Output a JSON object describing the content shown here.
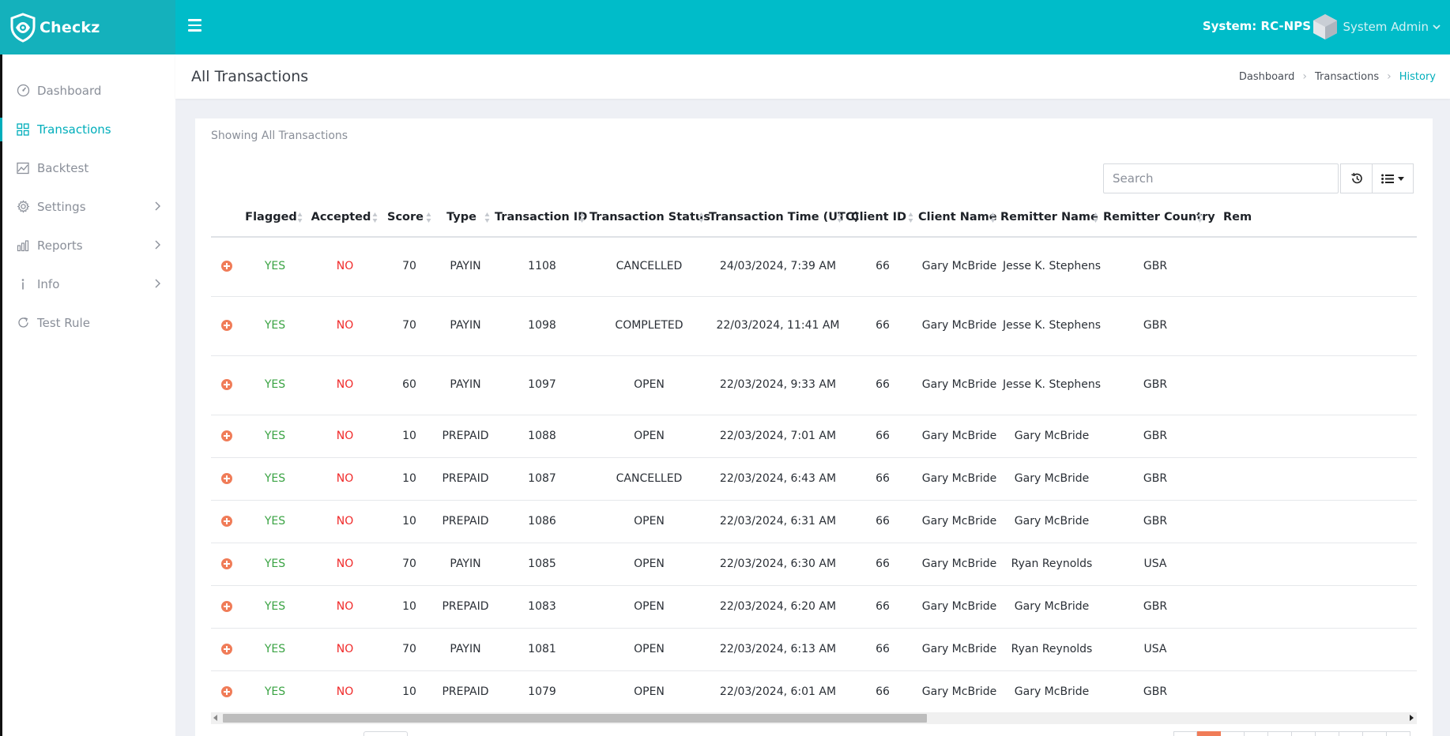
{
  "app": {
    "name": "Checkz"
  },
  "topbar": {
    "system_label": "System: RC-NPS",
    "user_name": "System Admin"
  },
  "sidebar": {
    "items": [
      {
        "label": "Dashboard",
        "icon": "speedometer-icon",
        "active": false,
        "has_submenu": false
      },
      {
        "label": "Transactions",
        "icon": "grid-icon",
        "active": true,
        "has_submenu": false
      },
      {
        "label": "Backtest",
        "icon": "image-chart-icon",
        "active": false,
        "has_submenu": false
      },
      {
        "label": "Settings",
        "icon": "gear-icon",
        "active": false,
        "has_submenu": true
      },
      {
        "label": "Reports",
        "icon": "bar-chart-icon",
        "active": false,
        "has_submenu": true
      },
      {
        "label": "Info",
        "icon": "info-icon",
        "active": false,
        "has_submenu": true
      },
      {
        "label": "Test Rule",
        "icon": "refresh-icon",
        "active": false,
        "has_submenu": false
      }
    ]
  },
  "header": {
    "title": "All Transactions",
    "breadcrumb": [
      "Dashboard",
      "Transactions",
      "History"
    ]
  },
  "card": {
    "subtitle": "Showing All Transactions",
    "search_placeholder": "Search"
  },
  "table": {
    "columns": [
      "",
      "Flagged",
      "Accepted",
      "Score",
      "Type",
      "Transaction ID",
      "Transaction Status",
      "Transaction Time (UTC)",
      "Client ID",
      "Client Name",
      "Remitter Name",
      "Remitter Country",
      "Rem"
    ],
    "rows": [
      [
        "YES",
        "NO",
        "70",
        "PAYIN",
        "1108",
        "CANCELLED",
        "24/03/2024, 7:39 AM",
        "66",
        "Gary McBride",
        "Jesse K. Stephens",
        "GBR"
      ],
      [
        "YES",
        "NO",
        "70",
        "PAYIN",
        "1098",
        "COMPLETED",
        "22/03/2024, 11:41 AM",
        "66",
        "Gary McBride",
        "Jesse K. Stephens",
        "GBR"
      ],
      [
        "YES",
        "NO",
        "60",
        "PAYIN",
        "1097",
        "OPEN",
        "22/03/2024, 9:33 AM",
        "66",
        "Gary McBride",
        "Jesse K. Stephens",
        "GBR"
      ],
      [
        "YES",
        "NO",
        "10",
        "PREPAID",
        "1088",
        "OPEN",
        "22/03/2024, 7:01 AM",
        "66",
        "Gary McBride",
        "Gary McBride",
        "GBR"
      ],
      [
        "YES",
        "NO",
        "10",
        "PREPAID",
        "1087",
        "CANCELLED",
        "22/03/2024, 6:43 AM",
        "66",
        "Gary McBride",
        "Gary McBride",
        "GBR"
      ],
      [
        "YES",
        "NO",
        "10",
        "PREPAID",
        "1086",
        "OPEN",
        "22/03/2024, 6:31 AM",
        "66",
        "Gary McBride",
        "Gary McBride",
        "GBR"
      ],
      [
        "YES",
        "NO",
        "70",
        "PAYIN",
        "1085",
        "OPEN",
        "22/03/2024, 6:30 AM",
        "66",
        "Gary McBride",
        "Ryan Reynolds",
        "USA"
      ],
      [
        "YES",
        "NO",
        "10",
        "PREPAID",
        "1083",
        "OPEN",
        "22/03/2024, 6:20 AM",
        "66",
        "Gary McBride",
        "Gary McBride",
        "GBR"
      ],
      [
        "YES",
        "NO",
        "70",
        "PAYIN",
        "1081",
        "OPEN",
        "22/03/2024, 6:13 AM",
        "66",
        "Gary McBride",
        "Ryan Reynolds",
        "USA"
      ],
      [
        "YES",
        "NO",
        "10",
        "PREPAID",
        "1079",
        "OPEN",
        "22/03/2024, 6:01 AM",
        "66",
        "Gary McBride",
        "Gary McBride",
        "GBR"
      ]
    ]
  },
  "colors": {
    "brand": "#00bcc9",
    "brand_dark": "#14b1bc",
    "accent": "#00aebb",
    "yes": "#3aa343",
    "no": "#f02a2a",
    "expand": "#f07c58"
  }
}
